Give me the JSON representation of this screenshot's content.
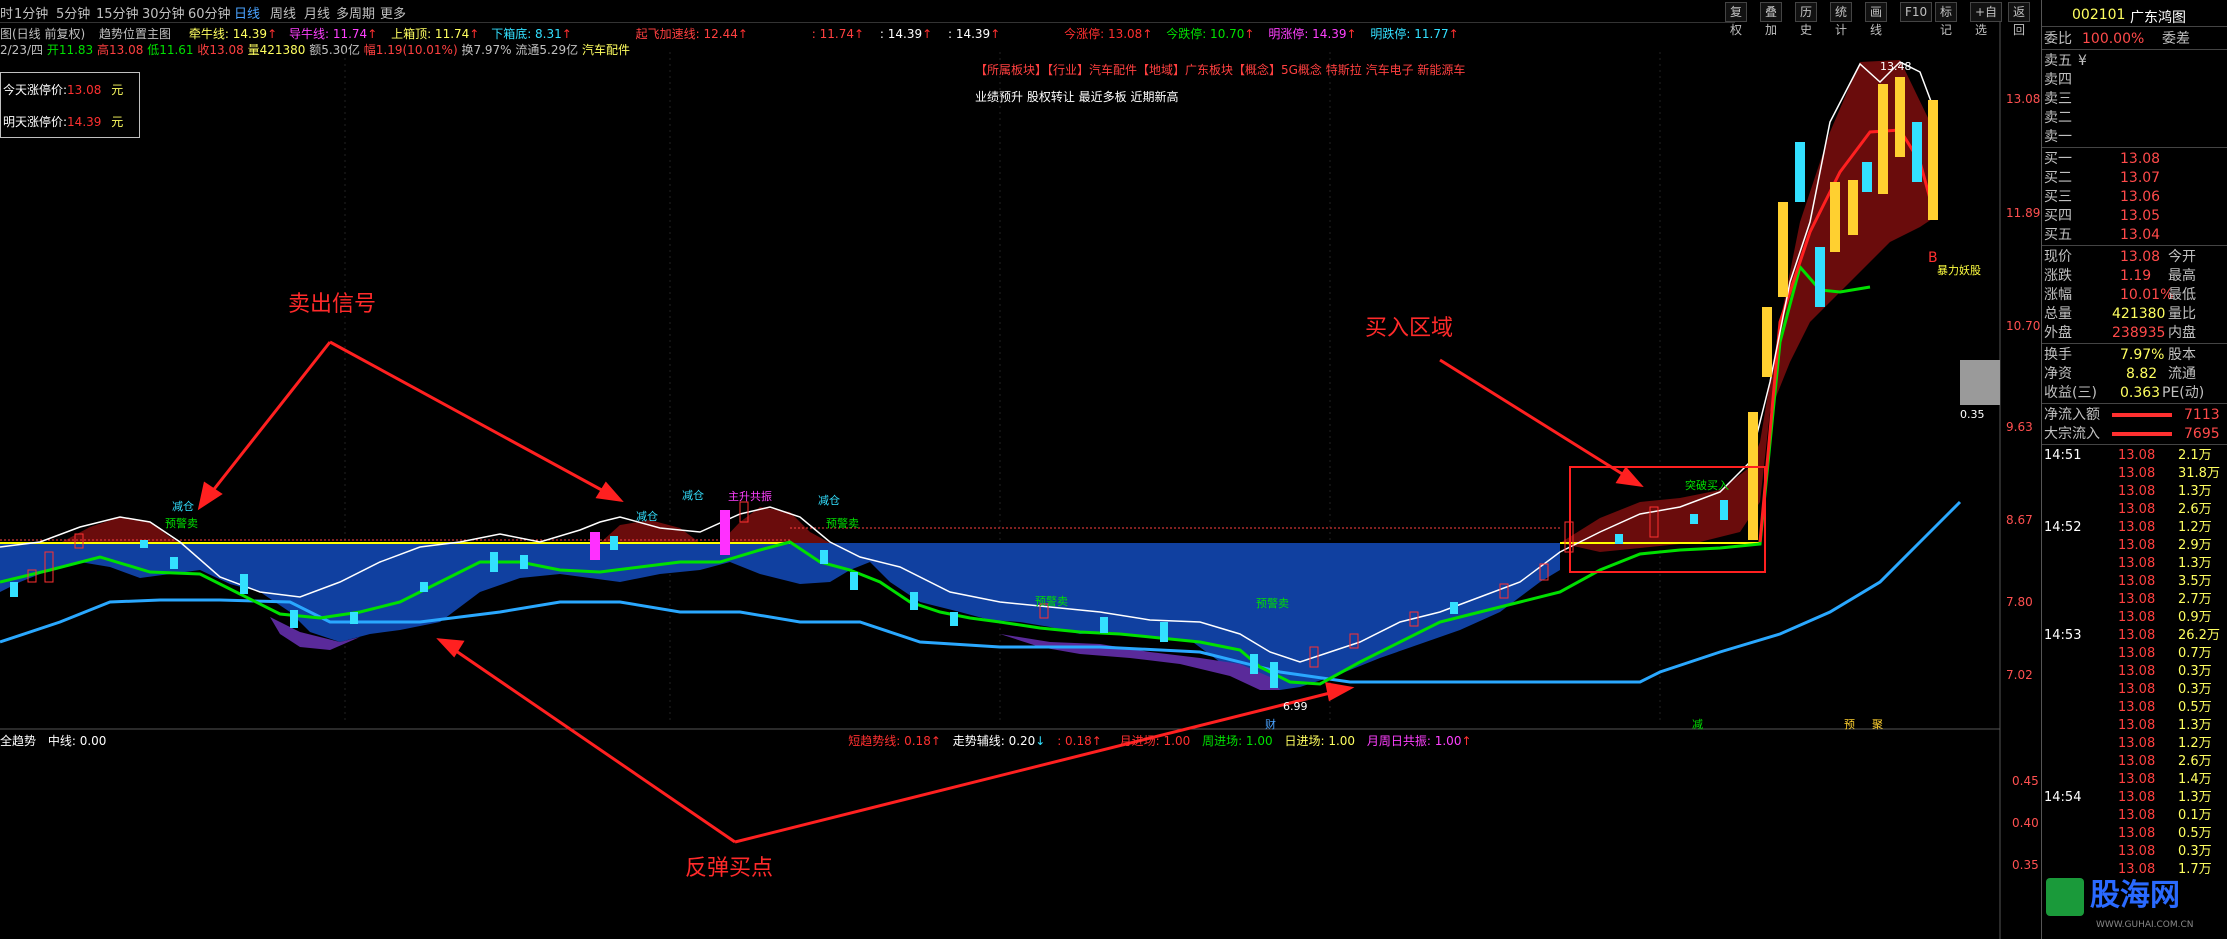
{
  "toolbar": {
    "periods": [
      "时",
      "1分钟",
      "5分钟",
      "15分钟",
      "30分钟",
      "60分钟",
      "日线",
      "周线",
      "月线",
      "多周期",
      "更多"
    ],
    "active_period": "日线",
    "buttons": [
      "复权",
      "叠加",
      "历史",
      "统计",
      "画线",
      "F10",
      "标记",
      "+自选",
      "返回"
    ]
  },
  "info_line1": {
    "title": "图(日线 前复权)",
    "indicator": "趋势位置主图",
    "qianniu": "牵牛线: 14.39",
    "daoniu": "导牛线: 11.74",
    "shangxiang": "上箱顶: 11.74",
    "xiaxiang": "下箱底: 8.31",
    "qifei": "起飞加速线: 12.44",
    "v1": ": 11.74",
    "v2": ": 14.39",
    "v3": ": 14.39",
    "jinzhang": "今涨停: 13.08",
    "jindie": "今跌停: 10.70",
    "mingzhang": "明涨停: 14.39",
    "mingdie": "明跌停: 11.77"
  },
  "info_line2": {
    "date": "2/23/四",
    "open": "开11.83",
    "high": "高13.08",
    "low": "低11.61",
    "close": "收13.08",
    "volume": "量421380",
    "amount": "额5.30亿",
    "change": "幅1.19(10.01%)",
    "turnover": "换7.97%",
    "float": "流通5.29亿",
    "sector": "汽车配件"
  },
  "limit_box": {
    "today_label": "今天涨停价:",
    "today_value": "13.08",
    "today_unit": "元",
    "tomorrow_label": "明天涨停价:",
    "tomorrow_value": "14.39",
    "tomorrow_unit": "元"
  },
  "concepts": {
    "line1": "【所属板块】【行业】汽车配件【地域】广东板块【概念】5G概念 特斯拉 汽车电子 新能源车",
    "line2": "业绩预升 股权转让 最近多板 近期新高"
  },
  "price_axis": [
    "13.08",
    "11.89",
    "10.70",
    "9.63",
    "8.67",
    "7.80",
    "7.02"
  ],
  "sub_axis": [
    "0.45",
    "0.40",
    "0.35"
  ],
  "chart_labels": {
    "peak": "13.48",
    "low_val": "6.99",
    "gray_val": "0.35",
    "b_marker": "B",
    "baoli": "暴力妖股",
    "reduce": "减仓",
    "warn_sell": "预警卖",
    "main_rise": "主升共振",
    "rebound": "反弹买点",
    "buy_zone_tag": "突破买入",
    "cai": "财",
    "jian": "减",
    "yu": "预",
    "ju": "聚"
  },
  "sub_info": {
    "name": "全趋势",
    "mid": "中线: 0.00",
    "short": "短趋势线: 0.18",
    "walk": "走势辅线: 0.20",
    "v": ": 0.18",
    "month_in": "月进场: 1.00",
    "week_in": "周进场: 1.00",
    "day_in": "日进场: 1.00",
    "resonance": "月周日共振: 1.00"
  },
  "annotations": {
    "sell_signal": "卖出信号",
    "buy_zone": "买入区域",
    "rebound_buy": "反弹买点"
  },
  "quote": {
    "code": "002101",
    "name": "广东鸿图",
    "wb_label": "委比",
    "wb_value": "100.00%",
    "wc_label": "委差",
    "asks": [
      {
        "label": "卖五",
        "price": "¥"
      },
      {
        "label": "卖四",
        "price": ""
      },
      {
        "label": "卖三",
        "price": ""
      },
      {
        "label": "卖二",
        "price": ""
      },
      {
        "label": "卖一",
        "price": ""
      }
    ],
    "bids": [
      {
        "label": "买一",
        "price": "13.08"
      },
      {
        "label": "买二",
        "price": "13.07"
      },
      {
        "label": "买三",
        "price": "13.06"
      },
      {
        "label": "买四",
        "price": "13.05"
      },
      {
        "label": "买五",
        "price": "13.04"
      }
    ],
    "stats": [
      {
        "l1": "现价",
        "v1": "13.08",
        "l2": "今开"
      },
      {
        "l1": "涨跌",
        "v1": "1.19",
        "l2": "最高"
      },
      {
        "l1": "涨幅",
        "v1": "10.01%",
        "l2": "最低"
      },
      {
        "l1": "总量",
        "v1": "421380",
        "l2": "量比"
      },
      {
        "l1": "外盘",
        "v1": "238935",
        "l2": "内盘"
      }
    ],
    "stats2": [
      {
        "l1": "换手",
        "v1": "7.97%",
        "l2": "股本"
      },
      {
        "l1": "净资",
        "v1": "8.82",
        "l2": "流通"
      },
      {
        "l1": "收益(三)",
        "v1": "0.363",
        "l2": "PE(动)"
      }
    ],
    "flows": [
      {
        "label": "净流入额",
        "value": "7113"
      },
      {
        "label": "大宗流入",
        "value": "7695"
      }
    ],
    "ticks": [
      {
        "time": "14:51",
        "price": "13.08",
        "vol": "2.1万"
      },
      {
        "time": "",
        "price": "13.08",
        "vol": "31.8万"
      },
      {
        "time": "",
        "price": "13.08",
        "vol": "1.3万"
      },
      {
        "time": "",
        "price": "13.08",
        "vol": "2.6万"
      },
      {
        "time": "14:52",
        "price": "13.08",
        "vol": "1.2万"
      },
      {
        "time": "",
        "price": "13.08",
        "vol": "2.9万"
      },
      {
        "time": "",
        "price": "13.08",
        "vol": "1.3万"
      },
      {
        "time": "",
        "price": "13.08",
        "vol": "3.5万"
      },
      {
        "time": "",
        "price": "13.08",
        "vol": "2.7万"
      },
      {
        "time": "",
        "price": "13.08",
        "vol": "0.9万"
      },
      {
        "time": "14:53",
        "price": "13.08",
        "vol": "26.2万"
      },
      {
        "time": "",
        "price": "13.08",
        "vol": "0.7万"
      },
      {
        "time": "",
        "price": "13.08",
        "vol": "0.3万"
      },
      {
        "time": "",
        "price": "13.08",
        "vol": "0.3万"
      },
      {
        "time": "",
        "price": "13.08",
        "vol": "0.5万"
      },
      {
        "time": "",
        "price": "13.08",
        "vol": "1.3万"
      },
      {
        "time": "",
        "price": "13.08",
        "vol": "1.2万"
      },
      {
        "time": "",
        "price": "13.08",
        "vol": "2.6万"
      },
      {
        "time": "",
        "price": "13.08",
        "vol": "1.4万"
      },
      {
        "time": "14:54",
        "price": "13.08",
        "vol": "1.3万"
      },
      {
        "time": "",
        "price": "13.08",
        "vol": "0.1万"
      },
      {
        "time": "",
        "price": "13.08",
        "vol": "0.5万"
      },
      {
        "time": "",
        "price": "13.08",
        "vol": "0.3万"
      },
      {
        "time": "",
        "price": "13.08",
        "vol": "1.7万"
      }
    ]
  },
  "watermark": {
    "brand": "股海网",
    "url": "WWW.GUHAI.COM.CN"
  },
  "colors": {
    "red": "#ff3030",
    "cyan": "#33e0ff",
    "yellow": "#ffff00",
    "blue_fill": "#1040a0",
    "dark_red_fill": "#6a0c0c",
    "green": "#00e000",
    "purple": "#5a2a9a",
    "lightblue": "#2aa8ff"
  }
}
